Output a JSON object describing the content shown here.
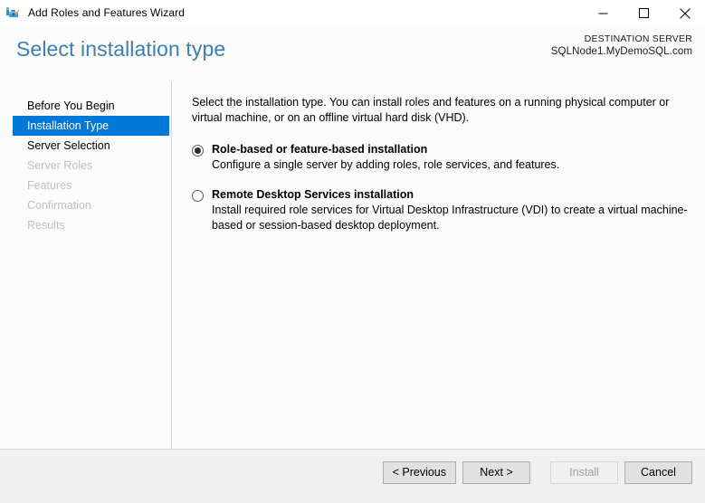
{
  "window": {
    "title": "Add Roles and Features Wizard",
    "icon": "toolbox-icon",
    "controls": {
      "minimize": "minimize-icon",
      "maximize": "maximize-icon",
      "close": "close-icon"
    }
  },
  "header": {
    "page_title": "Select installation type",
    "destination_label": "DESTINATION SERVER",
    "destination_value": "SQLNode1.MyDemoSQL.com"
  },
  "navigation": {
    "items": [
      {
        "label": "Before You Begin",
        "state": "enabled"
      },
      {
        "label": "Installation Type",
        "state": "selected"
      },
      {
        "label": "Server Selection",
        "state": "enabled"
      },
      {
        "label": "Server Roles",
        "state": "disabled"
      },
      {
        "label": "Features",
        "state": "disabled"
      },
      {
        "label": "Confirmation",
        "state": "disabled"
      },
      {
        "label": "Results",
        "state": "disabled"
      }
    ]
  },
  "main": {
    "intro": "Select the installation type. You can install roles and features on a running physical computer or virtual machine, or on an offline virtual hard disk (VHD).",
    "options": [
      {
        "title": "Role-based or feature-based installation",
        "description": "Configure a single server by adding roles, role services, and features.",
        "selected": true
      },
      {
        "title": "Remote Desktop Services installation",
        "description": "Install required role services for Virtual Desktop Infrastructure (VDI) to create a virtual machine-based or session-based desktop deployment.",
        "selected": false
      }
    ]
  },
  "footer": {
    "previous_label": "< Previous",
    "next_label": "Next >",
    "install_label": "Install",
    "cancel_label": "Cancel",
    "install_disabled": true
  },
  "colors": {
    "accent_blue": "#0078d7",
    "title_blue": "#3c7fb1",
    "body_background": "#fbfbfb",
    "footer_background": "#f0f0f0",
    "disabled_text": "#bfbfbf"
  }
}
